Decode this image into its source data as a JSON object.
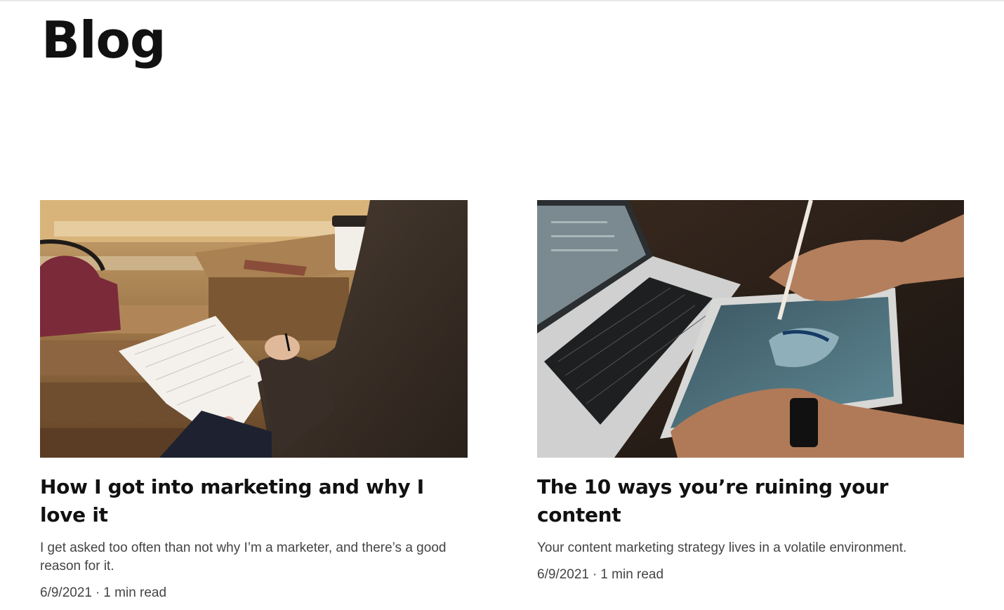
{
  "page": {
    "title": "Blog"
  },
  "posts": [
    {
      "title": "How I got into marketing and why I love it",
      "excerpt": "I get asked too often than not why I’m a marketer, and there’s a good reason for it.",
      "date": "6/9/2021",
      "separator": "·",
      "read_time": "1 min read",
      "image_icon": "photo-notebook-writing"
    },
    {
      "title": "The 10 ways you’re ruining your content",
      "excerpt": "Your content marketing strategy lives in a volatile environment.",
      "date": "6/9/2021",
      "separator": "·",
      "read_time": "1 min read",
      "image_icon": "photo-laptop-tablet"
    }
  ],
  "colors": {
    "title": "#111111",
    "body_text": "#444444",
    "background": "#ffffff"
  }
}
